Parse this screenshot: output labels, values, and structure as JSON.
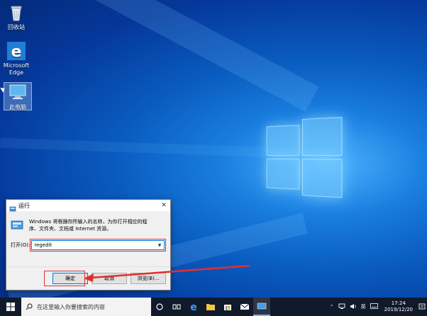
{
  "desktop": {
    "icons": [
      {
        "label": "回收站"
      },
      {
        "label": "Microsoft Edge"
      },
      {
        "label": "此电脑"
      }
    ]
  },
  "run_dialog": {
    "title": "运行",
    "description": "Windows 将根据你所输入的名称，为你打开相应的程序、文件夹、文档或 Internet 资源。",
    "open_label": "打开(O):",
    "input_value": "regedit",
    "buttons": {
      "ok": "确定",
      "cancel": "取消",
      "browse": "浏览(B)..."
    }
  },
  "taskbar": {
    "search_placeholder": "在这里输入你要搜索的内容",
    "tray_lang": "英",
    "clock_time": "17:24",
    "clock_date": "2019/12/20"
  },
  "colors": {
    "accent": "#0078d7",
    "highlight_red": "#e03030",
    "taskbar": "#101a2b"
  }
}
